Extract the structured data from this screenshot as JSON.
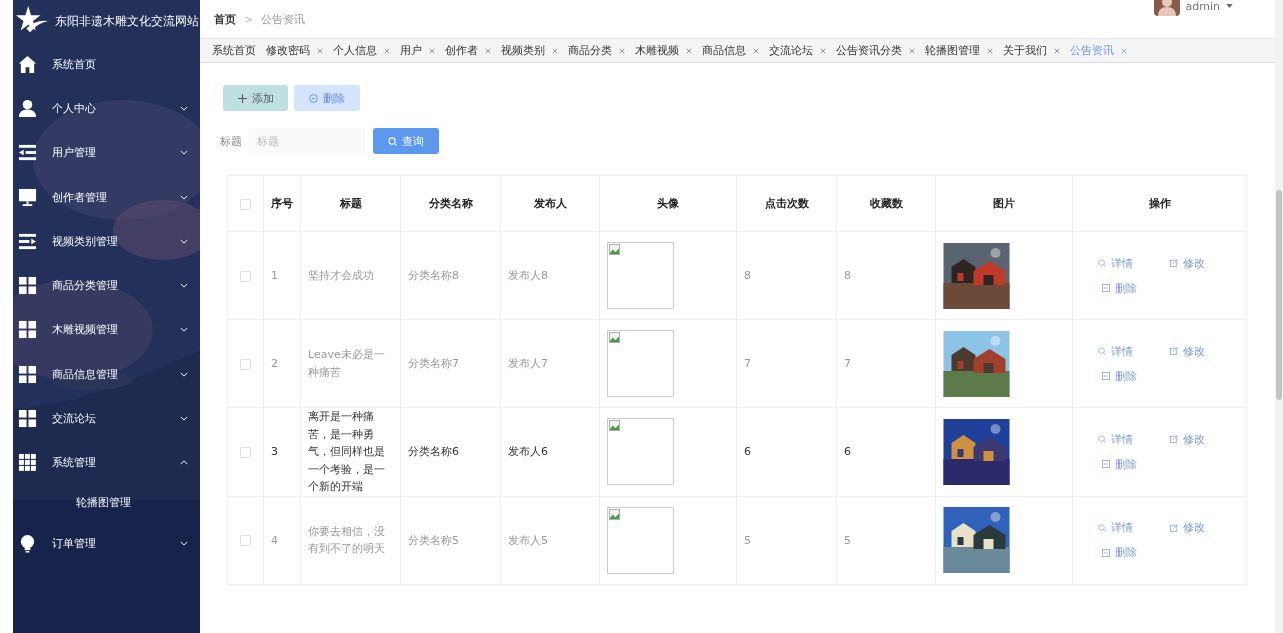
{
  "site_title": "东阳非遗木雕文化交流网站",
  "sidebar": {
    "items": [
      {
        "label": "系统首页",
        "kind": "home"
      },
      {
        "label": "个人中心",
        "kind": "person",
        "expanded": false
      },
      {
        "label": "用户管理",
        "kind": "indent",
        "expanded": false
      },
      {
        "label": "创作者管理",
        "kind": "monitor",
        "expanded": false
      },
      {
        "label": "视频类别管理",
        "kind": "list",
        "expanded": false
      },
      {
        "label": "商品分类管理",
        "kind": "grid4",
        "expanded": false
      },
      {
        "label": "木雕视频管理",
        "kind": "grid4",
        "expanded": false
      },
      {
        "label": "商品信息管理",
        "kind": "grid4",
        "expanded": false
      },
      {
        "label": "交流论坛",
        "kind": "grid4",
        "expanded": false
      },
      {
        "label": "系统管理",
        "kind": "grid9",
        "expanded": true,
        "children": [
          {
            "label": "轮播图管理"
          }
        ]
      },
      {
        "label": "订单管理",
        "kind": "bulb",
        "expanded": false
      }
    ]
  },
  "breadcrumb": [
    "首页",
    "公告资讯"
  ],
  "breadcrumb_separator": ">",
  "user": {
    "name": "admin"
  },
  "tabs": [
    {
      "label": "系统首页",
      "closable": false,
      "selected": false
    },
    {
      "label": "修改密码",
      "closable": true,
      "selected": false
    },
    {
      "label": "个人信息",
      "closable": true,
      "selected": false
    },
    {
      "label": "用户",
      "closable": true,
      "selected": false
    },
    {
      "label": "创作者",
      "closable": true,
      "selected": false
    },
    {
      "label": "视频类别",
      "closable": true,
      "selected": false
    },
    {
      "label": "商品分类",
      "closable": true,
      "selected": false
    },
    {
      "label": "木雕视频",
      "closable": true,
      "selected": false
    },
    {
      "label": "商品信息",
      "closable": true,
      "selected": false
    },
    {
      "label": "交流论坛",
      "closable": true,
      "selected": false
    },
    {
      "label": "公告资讯分类",
      "closable": true,
      "selected": false
    },
    {
      "label": "轮播图管理",
      "closable": true,
      "selected": false
    },
    {
      "label": "关于我们",
      "closable": true,
      "selected": false
    },
    {
      "label": "公告资讯",
      "closable": true,
      "selected": true
    }
  ],
  "toolbar": {
    "add": "添加",
    "delete": "删除"
  },
  "search": {
    "label": "标题",
    "placeholder": "标题",
    "button": "查询"
  },
  "table": {
    "all_checked": false,
    "columns": [
      "序号",
      "标题",
      "分类名称",
      "发布人",
      "头像",
      "点击次数",
      "收藏数",
      "图片",
      "操作"
    ],
    "rows": [
      {
        "checked": false,
        "highlighted": false,
        "index": "1",
        "title": "坚持才会成功",
        "category": "分类名称8",
        "publisher": "发布人8",
        "clicks": "8",
        "favorites": "8",
        "actions": [
          "详情",
          "修改",
          "删除"
        ]
      },
      {
        "checked": false,
        "highlighted": false,
        "index": "2",
        "title": "Leave未必是一种痛苦",
        "category": "分类名称7",
        "publisher": "发布人7",
        "clicks": "7",
        "favorites": "7",
        "actions": [
          "详情",
          "修改",
          "删除"
        ]
      },
      {
        "checked": false,
        "highlighted": true,
        "index": "3",
        "title": "离开是一种痛苦，是一种勇气，但同样也是一个考验，是一个新的开端",
        "category": "分类名称6",
        "publisher": "发布人6",
        "clicks": "6",
        "favorites": "6",
        "actions": [
          "详情",
          "修改",
          "删除"
        ]
      },
      {
        "checked": false,
        "highlighted": false,
        "index": "4",
        "title": "你要去相信，没有到不了的明天",
        "category": "分类名称5",
        "publisher": "发布人5",
        "clicks": "5",
        "favorites": "5",
        "actions": [
          "详情",
          "修改",
          "删除"
        ]
      }
    ]
  }
}
